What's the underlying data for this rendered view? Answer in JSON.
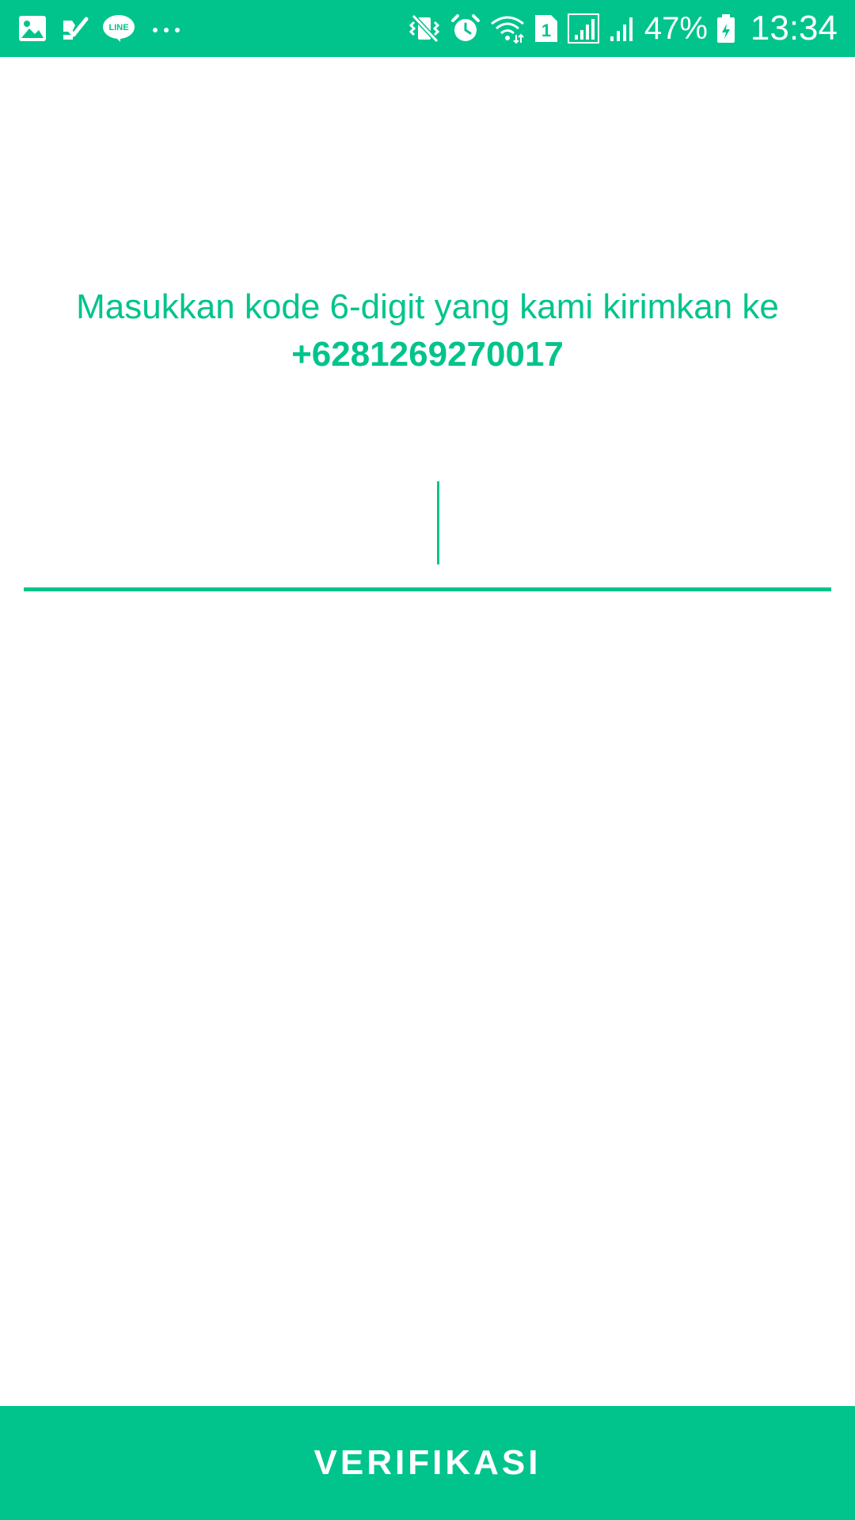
{
  "status_bar": {
    "left_icons": [
      "gallery-icon",
      "task-check-icon",
      "line-app-icon",
      "more-dots-icon"
    ],
    "right_icons": [
      "vibrate-mute-icon",
      "alarm-icon",
      "wifi-icon",
      "sim-1-icon",
      "signal-icon",
      "signal-2-icon",
      "battery-charging-icon"
    ],
    "line_logo_text": "LINE",
    "sim_label": "1",
    "battery_percent": "47%",
    "time": "13:34"
  },
  "prompt": {
    "message": "Masukkan kode 6-digit yang kami kirimkan ke",
    "phone_number": "+6281269270017"
  },
  "code_input": {
    "value": "",
    "placeholder": ""
  },
  "verify_button": {
    "label": "VERIFIKASI"
  },
  "colors": {
    "accent": "#00C48C",
    "background": "#ffffff",
    "on_accent": "#ffffff"
  }
}
